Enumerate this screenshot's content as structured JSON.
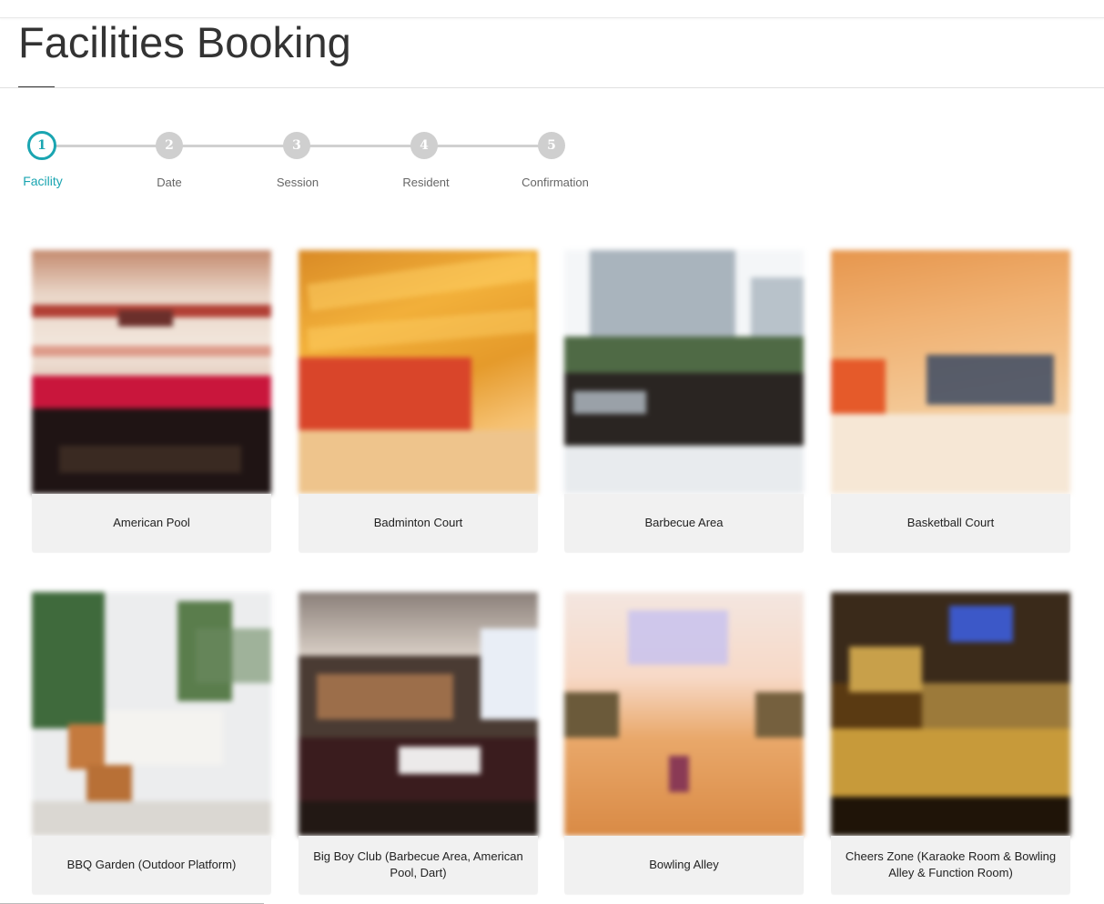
{
  "page": {
    "title": "Facilities Booking"
  },
  "stepper": {
    "steps": [
      {
        "number": "1",
        "label": "Facility",
        "active": true
      },
      {
        "number": "2",
        "label": "Date",
        "active": false
      },
      {
        "number": "3",
        "label": "Session",
        "active": false
      },
      {
        "number": "4",
        "label": "Resident",
        "active": false
      },
      {
        "number": "5",
        "label": "Confirmation",
        "active": false
      }
    ],
    "active_color": "#1aa5b1",
    "inactive_color": "#cfcfcf"
  },
  "facilities": [
    {
      "name": "American Pool",
      "image": "american-pool-photo"
    },
    {
      "name": "Badminton Court",
      "image": "badminton-court-photo"
    },
    {
      "name": "Barbecue Area",
      "image": "barbecue-area-photo"
    },
    {
      "name": "Basketball Court",
      "image": "basketball-court-photo"
    },
    {
      "name": "BBQ Garden (Outdoor Platform)",
      "image": "bbq-garden-photo"
    },
    {
      "name": "Big Boy Club (Barbecue Area, American Pool, Dart)",
      "image": "big-boy-club-photo"
    },
    {
      "name": "Bowling Alley",
      "image": "bowling-alley-photo"
    },
    {
      "name": "Cheers Zone (Karaoke Room & Bowling Alley & Function Room)",
      "image": "cheers-zone-photo"
    }
  ]
}
